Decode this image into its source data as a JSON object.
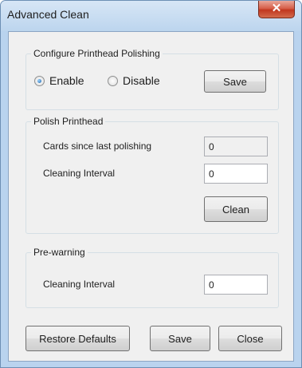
{
  "window": {
    "title": "Advanced Clean",
    "close_glyph": "✕"
  },
  "polishing_group": {
    "legend": "Configure Printhead Polishing",
    "enable_label": "Enable",
    "disable_label": "Disable",
    "selected": "Enable",
    "save_label": "Save"
  },
  "polish_group": {
    "legend": "Polish Printhead",
    "cards_label": "Cards since last polishing",
    "cards_value": "0",
    "interval_label": "Cleaning Interval",
    "interval_value": "0",
    "clean_label": "Clean"
  },
  "prewarning_group": {
    "legend": "Pre-warning",
    "interval_label": "Cleaning Interval",
    "interval_value": "0"
  },
  "footer": {
    "restore_label": "Restore Defaults",
    "save_label": "Save",
    "close_label": "Close"
  }
}
